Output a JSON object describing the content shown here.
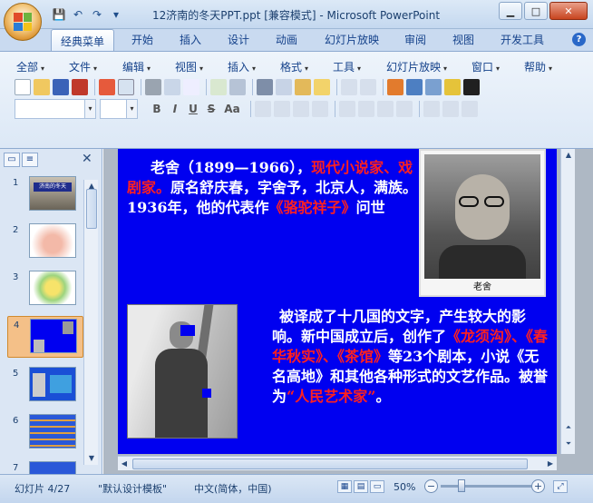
{
  "window": {
    "title": "12济南的冬天PPT.ppt [兼容模式] - Microsoft PowerPoint",
    "min_glyph": "▁",
    "max_glyph": "□",
    "close_glyph": "✕"
  },
  "qat": {
    "save_glyph": "💾",
    "undo_glyph": "↶",
    "redo_glyph": "↷",
    "more_glyph": "▾"
  },
  "ribbon_tabs": [
    "经典菜单",
    "开始",
    "插入",
    "设计",
    "动画",
    "幻灯片放映",
    "审阅",
    "视图",
    "开发工具"
  ],
  "help_glyph": "?",
  "classic_menus": [
    "全部",
    "文件",
    "编辑",
    "视图",
    "插入",
    "格式",
    "工具",
    "幻灯片放映",
    "窗口",
    "帮助"
  ],
  "menu_arrow": "▾",
  "format_buttons": [
    "B",
    "I",
    "U",
    "S",
    "Aa"
  ],
  "pane": {
    "tab_slides_glyph": "▭",
    "tab_outline_glyph": "≡",
    "close_glyph": "✕",
    "slide_numbers": [
      "1",
      "2",
      "3",
      "4",
      "5",
      "6",
      "7"
    ],
    "thumb1_title": "济南的冬天"
  },
  "slide": {
    "para1_start": "老舍（1899—1966），",
    "para1_red1": "现代小说家、戏剧家。",
    "para1_mid": "原名舒庆春，字舍予，北京人，满族。1936年，他的代表作",
    "para1_red2": "《骆驼祥子》",
    "para1_end": "问世",
    "photo_caption": "老舍",
    "para2_start": "被译成了十几国的文字，产生较大的影响。新中国成立后，创作了",
    "para2_red1": "《龙须沟》、《春华秋实》、《茶馆》",
    "para2_mid": "等23个剧本，小说《无名高地》和其他各种形式的文艺作品。被誉为",
    "para2_red2": "“人民艺术家”",
    "para2_end": "。"
  },
  "status": {
    "slide_pos": "幻灯片 4/27",
    "template": "\"默认设计模板\"",
    "language": "中文(简体，中国)",
    "zoom": "50%",
    "zoom_minus": "−",
    "zoom_plus": "+"
  },
  "colors": {
    "slide_bg": "#0000f0",
    "highlight": "#ff2020",
    "ribbon": "#dce8f6"
  }
}
